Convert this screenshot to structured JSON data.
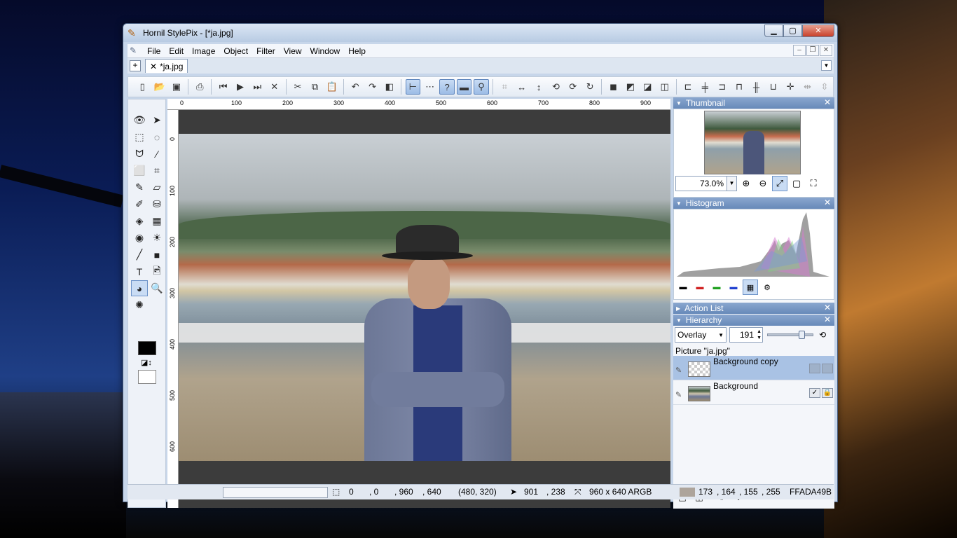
{
  "window": {
    "title": "Hornil StylePix - [*ja.jpg]"
  },
  "menu": {
    "items": [
      "File",
      "Edit",
      "Image",
      "Object",
      "Filter",
      "View",
      "Window",
      "Help"
    ]
  },
  "tabs": [
    {
      "label": "*ja.jpg"
    }
  ],
  "ruler": {
    "top": [
      "0",
      "100",
      "200",
      "300",
      "400",
      "500",
      "600",
      "700",
      "800",
      "900"
    ],
    "left": [
      "0",
      "100",
      "200",
      "300",
      "400",
      "500",
      "600"
    ]
  },
  "panels": {
    "thumbnail": {
      "title": "Thumbnail",
      "zoom": "73.0%"
    },
    "histogram": {
      "title": "Histogram"
    },
    "action_list": {
      "title": "Action List"
    },
    "hierarchy": {
      "title": "Hierarchy",
      "blend_mode": "Overlay",
      "opacity": "191",
      "opacity_level": 0.749,
      "picture_label": "Picture \"ja.jpg\"",
      "layers": [
        {
          "name": "Background copy",
          "selected": true
        },
        {
          "name": "Background",
          "selected": false
        }
      ]
    }
  },
  "status": {
    "sel_x": "0",
    "sel_y": ", 0",
    "sel_w": ", 960",
    "sel_h": ", 640",
    "center": "(480, 320)",
    "cursor_x": "901",
    "cursor_y": ", 238",
    "image_size": "960 x 640 ARGB",
    "color_r": "173",
    "color_g": ", 164",
    "color_b": ", 155",
    "color_a": ", 255",
    "color_hex": "FFADA49B",
    "swatch_color": "#ada49b"
  }
}
